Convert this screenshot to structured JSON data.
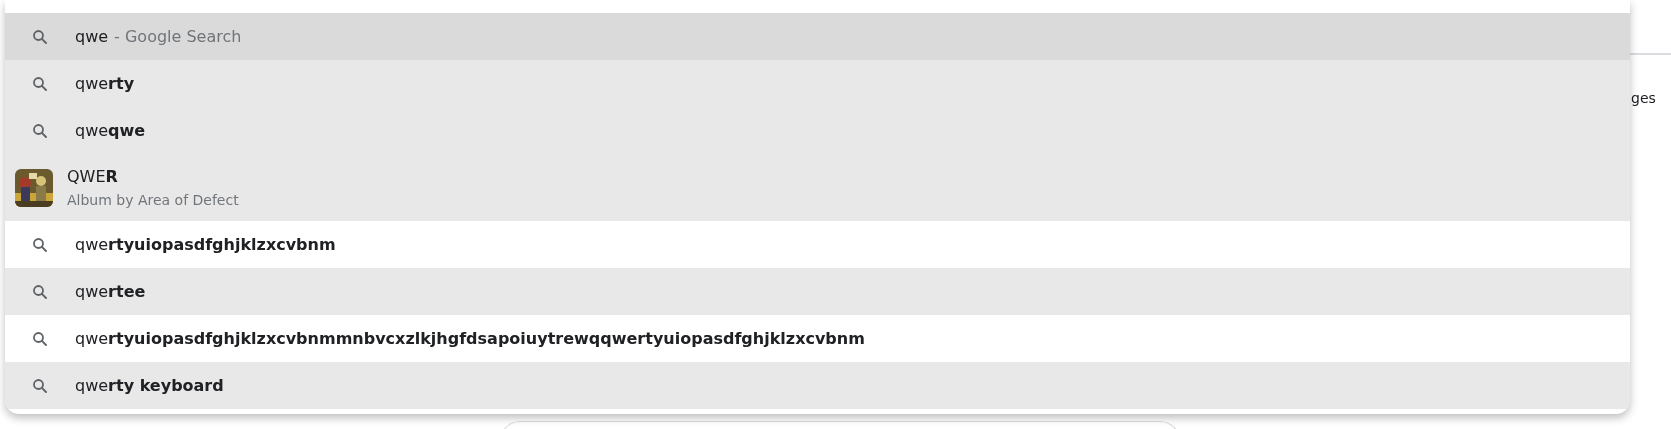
{
  "page_fragment": {
    "text": "ges"
  },
  "suggestions": [
    {
      "kind": "search",
      "text": "qwe",
      "suffix": "- Google Search",
      "selected": true
    },
    {
      "kind": "search",
      "text": "qwe**rty**",
      "selected": false,
      "shaded": true
    },
    {
      "kind": "search",
      "text": "qwe**qwe**",
      "selected": false,
      "shaded": true
    },
    {
      "kind": "entity",
      "text": "QWE**R**",
      "subtitle": "Album by Area of Defect",
      "selected": false,
      "shaded": true
    },
    {
      "kind": "search",
      "text": "qwe**rtyuiopasdfghjklzxcvbnm**",
      "selected": false,
      "shaded": false
    },
    {
      "kind": "search",
      "text": "qwe**rtee**",
      "selected": false,
      "shaded": true
    },
    {
      "kind": "search",
      "text": "qwe**rtyuiopasdfghjklzxcvbnmmnbvcxzlkjhgfdsapoiuytrewqqwertyuiopasdfghjklzxcvbnm**",
      "selected": false,
      "shaded": false
    },
    {
      "kind": "search",
      "text": "qwe**rty keyboard**",
      "selected": false,
      "shaded": true
    }
  ]
}
